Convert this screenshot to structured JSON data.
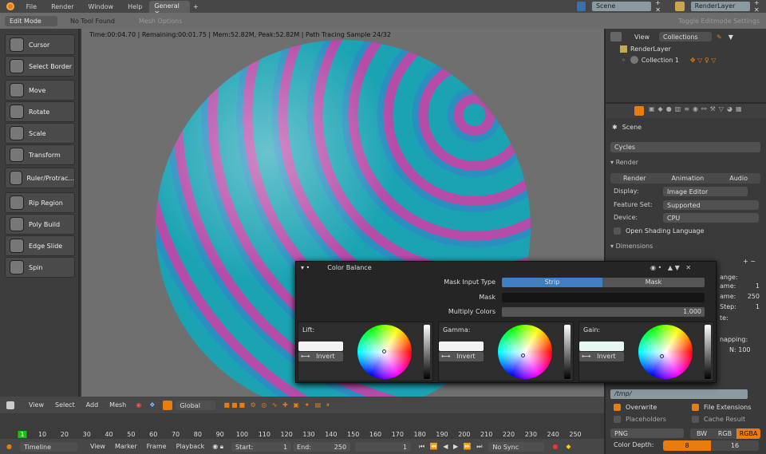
{
  "topbar": {
    "menus": [
      "File",
      "Render",
      "Window",
      "Help"
    ],
    "workspace_tab": "General",
    "scene": "Scene",
    "render_layer": "RenderLayer"
  },
  "header": {
    "mode": "Edit Mode",
    "tool": "No Tool Found",
    "mesh_options": "Mesh Options",
    "toggle": "Toggle Editmode Settings"
  },
  "tools": [
    "Cursor",
    "Select Border",
    "Move",
    "Rotate",
    "Scale",
    "Transform",
    "Ruler/Protrac...",
    "Rip Region",
    "Poly Build",
    "Edge Slide",
    "Spin"
  ],
  "viewport": {
    "status": "Time:00:04.70 | Remaining:00:01.75 | Mem:52.82M, Peak:52.82M | Path Tracing Sample 24/32"
  },
  "outliner": {
    "view": "View",
    "display": "Collections",
    "render_layer": "RenderLayer",
    "collection": "Collection 1"
  },
  "props": {
    "scene": "Scene",
    "engine": "Cycles",
    "render_panel": "Render",
    "render_btn": "Render",
    "animation_btn": "Animation",
    "audio_btn": "Audio",
    "display_label": "Display:",
    "display": "Image Editor",
    "feature_label": "Feature Set:",
    "feature": "Supported",
    "device_label": "Device:",
    "device": "CPU",
    "osl": "Open Shading Language",
    "dimensions": "Dimensions",
    "partial": [
      "ange:",
      "ame:",
      "ame:",
      "Step:",
      "te:",
      "napping:"
    ],
    "partial_vals": [
      "1",
      "250",
      "1",
      "N: 100"
    ],
    "path": "/tmp/",
    "overwrite": "Overwrite",
    "file_ext": "File Extensions",
    "placeholders": "Placeholders",
    "cache": "Cache Result",
    "format": "PNG",
    "bw": "BW",
    "rgb": "RGB",
    "rgba": "RGBA",
    "depth_label": "Color Depth:",
    "depth8": "8",
    "depth16": "16"
  },
  "popup": {
    "title": "Color Balance",
    "mask_input_label": "Mask Input Type",
    "strip": "Strip",
    "mask_opt": "Mask",
    "mask_label": "Mask",
    "multiply_label": "Multiply Colors",
    "multiply": "1.000",
    "lift": "Lift:",
    "gamma": "Gamma:",
    "gain": "Gain:",
    "invert": "Invert"
  },
  "vpheader": {
    "items": [
      "View",
      "Select",
      "Add",
      "Mesh"
    ],
    "orientation": "Global"
  },
  "timeline": {
    "ticks": [
      "1",
      "10",
      "20",
      "30",
      "40",
      "50",
      "60",
      "70",
      "80",
      "90",
      "100",
      "110",
      "120",
      "130",
      "140",
      "150",
      "160",
      "170",
      "180",
      "190",
      "200",
      "210",
      "220",
      "230",
      "240",
      "250"
    ],
    "editor": "Timeline",
    "menus": [
      "View",
      "Marker",
      "Frame",
      "Playback"
    ],
    "start_label": "Start:",
    "start": "1",
    "end_label": "End:",
    "end": "250",
    "current": "1",
    "sync": "No Sync"
  },
  "colors": {
    "accent": "#e87d0d",
    "strip": "#3d7fc1"
  }
}
